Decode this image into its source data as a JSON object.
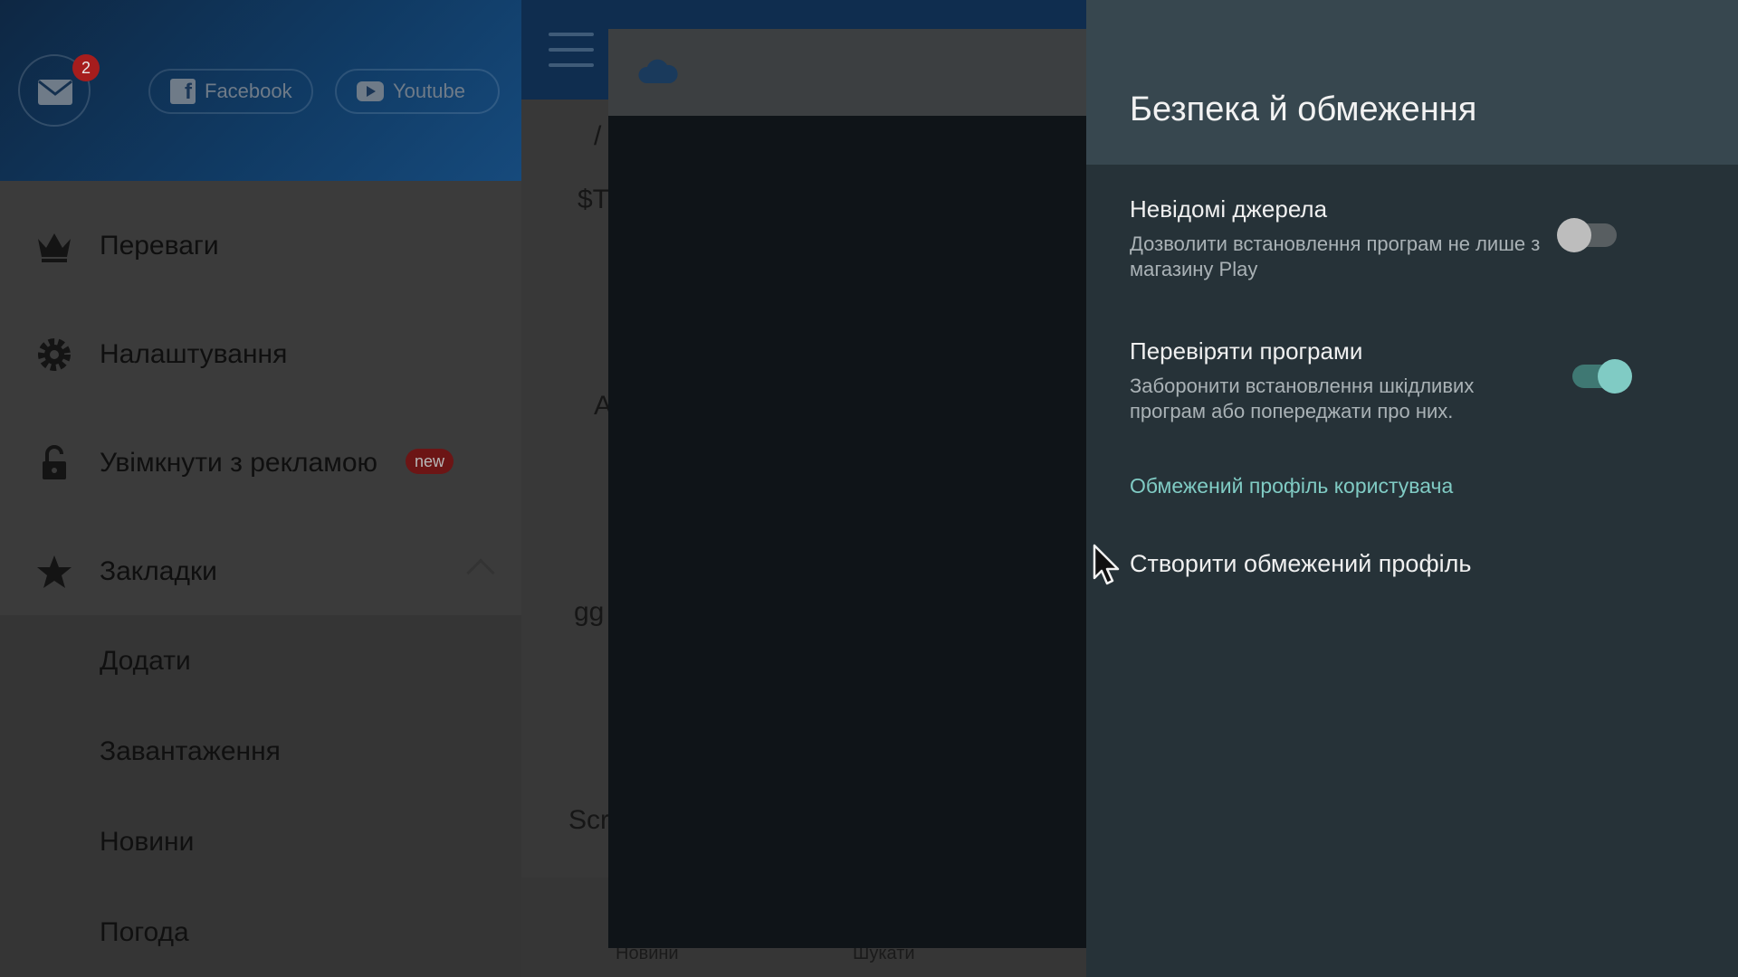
{
  "drawer": {
    "mail_badge": "2",
    "social": {
      "facebook": "Facebook",
      "youtube": "Youtube"
    },
    "items": [
      {
        "label": "Переваги",
        "icon": "crown-icon"
      },
      {
        "label": "Налаштування",
        "icon": "gear-icon"
      },
      {
        "label": "Увімкнути з рекламою",
        "icon": "unlock-icon",
        "badge": "new"
      },
      {
        "label": "Закладки",
        "icon": "star-icon"
      }
    ],
    "bookmarks_sub": [
      "Додати",
      "Завантаження",
      "Новини",
      "Погода"
    ]
  },
  "middle": {
    "peek_texts": [
      "/",
      "$T",
      "A",
      "gg",
      "Scr"
    ],
    "bottom_tabs": [
      "Новини",
      "Шукати"
    ]
  },
  "settings": {
    "title": "Безпека й обмеження",
    "unknown_sources": {
      "title": "Невідомі джерела",
      "summary": "Дозволити встановлення програм не лише з магазину Play",
      "enabled": false
    },
    "verify_apps": {
      "title": "Перевіряти програми",
      "summary": "Заборонити встановлення шкідливих програм або попереджати про них.",
      "enabled": true
    },
    "restricted_category": "Обмежений профіль користувача",
    "create_restricted": "Створити обмежений профіль"
  },
  "colors": {
    "panel_bg": "#263238",
    "panel_header": "#37474f",
    "accent": "#80cbc4",
    "badge_red": "#a61d1d"
  }
}
